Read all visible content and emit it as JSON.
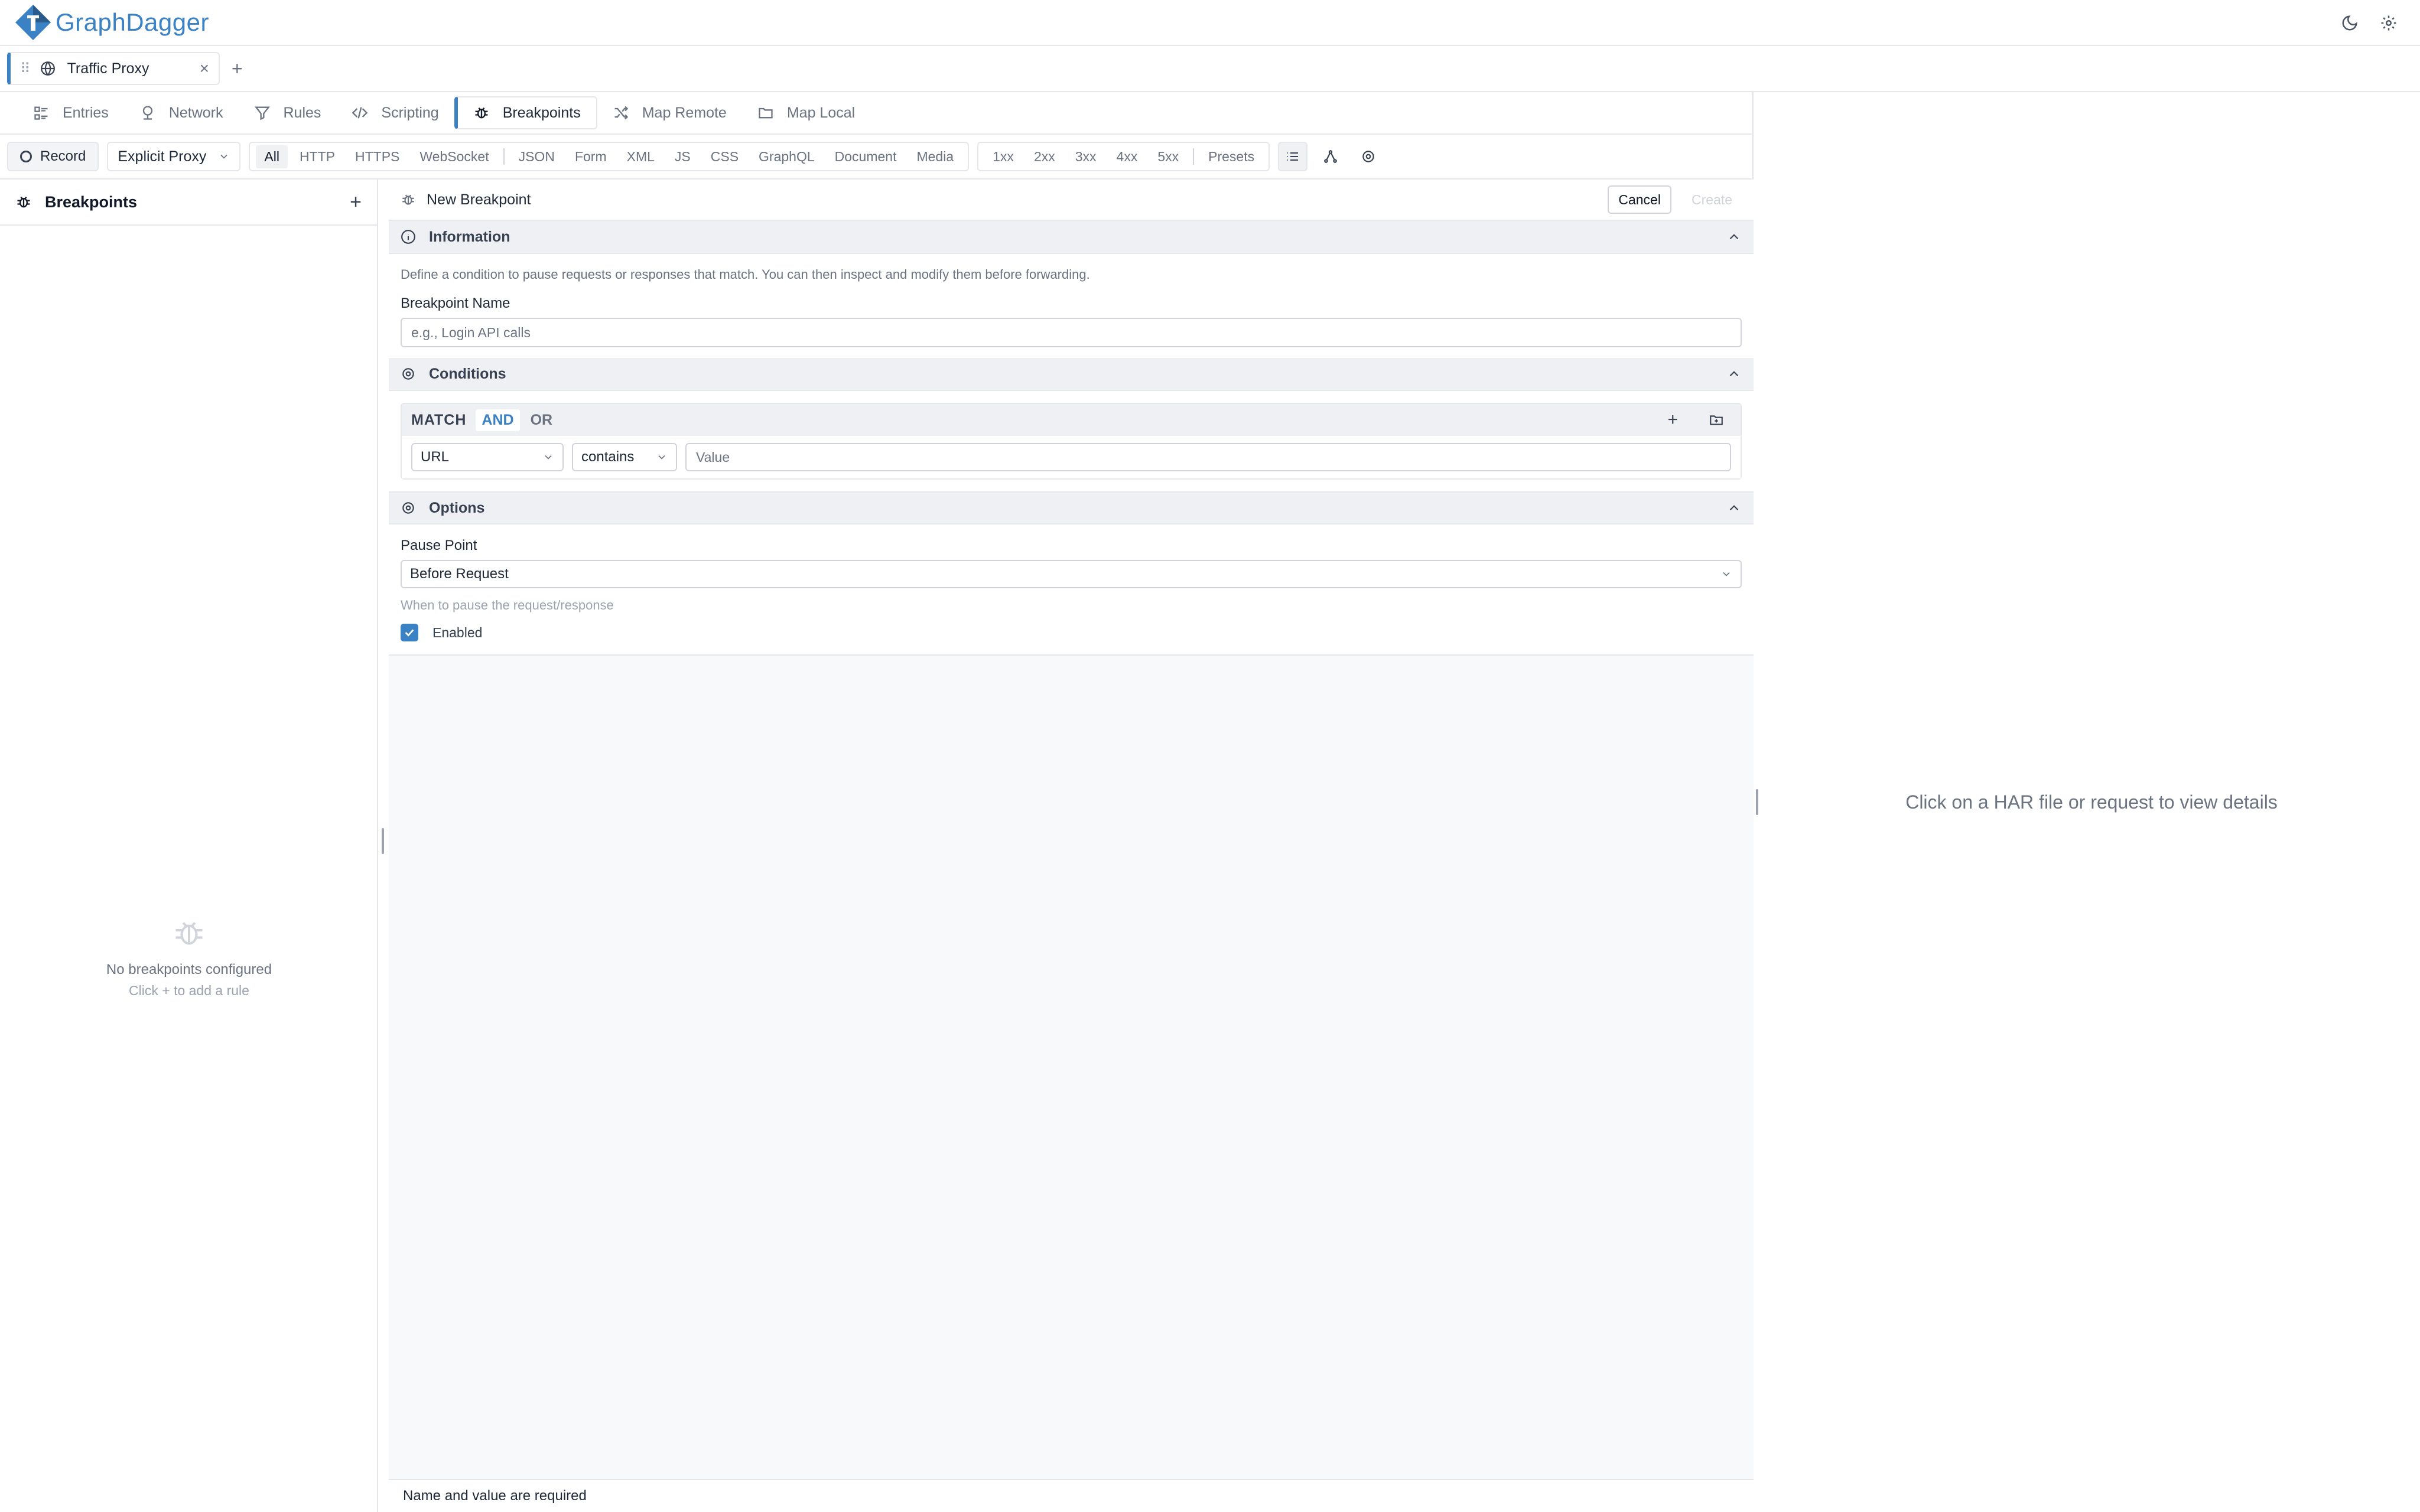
{
  "app": {
    "name": "GraphDagger"
  },
  "tabs": [
    {
      "label": "Traffic Proxy"
    }
  ],
  "nav": {
    "tabs": [
      {
        "label": "Entries",
        "icon": "list-icon"
      },
      {
        "label": "Network",
        "icon": "network-icon"
      },
      {
        "label": "Rules",
        "icon": "filter-icon"
      },
      {
        "label": "Scripting",
        "icon": "code-icon"
      },
      {
        "label": "Breakpoints",
        "icon": "bug-icon",
        "active": true
      },
      {
        "label": "Map Remote",
        "icon": "shuffle-icon"
      },
      {
        "label": "Map Local",
        "icon": "folder-icon"
      }
    ]
  },
  "toolbar": {
    "record_label": "Record",
    "proxy_mode": "Explicit Proxy",
    "type_filters": [
      "All",
      "HTTP",
      "HTTPS",
      "WebSocket",
      "JSON",
      "Form",
      "XML",
      "JS",
      "CSS",
      "GraphQL",
      "Document",
      "Media"
    ],
    "status_filters": [
      "1xx",
      "2xx",
      "3xx",
      "4xx",
      "5xx",
      "Presets"
    ]
  },
  "sidebar": {
    "title": "Breakpoints",
    "empty_message": "No breakpoints configured",
    "empty_hint": "Click + to add a rule"
  },
  "editor": {
    "title": "New Breakpoint",
    "cancel_label": "Cancel",
    "create_label": "Create",
    "information": {
      "title": "Information",
      "description": "Define a condition to pause requests or responses that match. You can then inspect and modify them before forwarding.",
      "name_label": "Breakpoint Name",
      "name_placeholder": "e.g., Login API calls"
    },
    "conditions": {
      "title": "Conditions",
      "match_label": "MATCH",
      "and_label": "AND",
      "or_label": "OR",
      "field": "URL",
      "operator": "contains",
      "value_placeholder": "Value"
    },
    "options": {
      "title": "Options",
      "pause_point_label": "Pause Point",
      "pause_point_value": "Before Request",
      "pause_point_hint": "When to pause the request/response",
      "enabled_label": "Enabled",
      "enabled": true
    },
    "status": "Name and value are required"
  },
  "detail": {
    "placeholder": "Click on a HAR file or request to view details"
  },
  "colors": {
    "accent": "#3b82c4",
    "logo_dark": "#2b5b8a"
  }
}
